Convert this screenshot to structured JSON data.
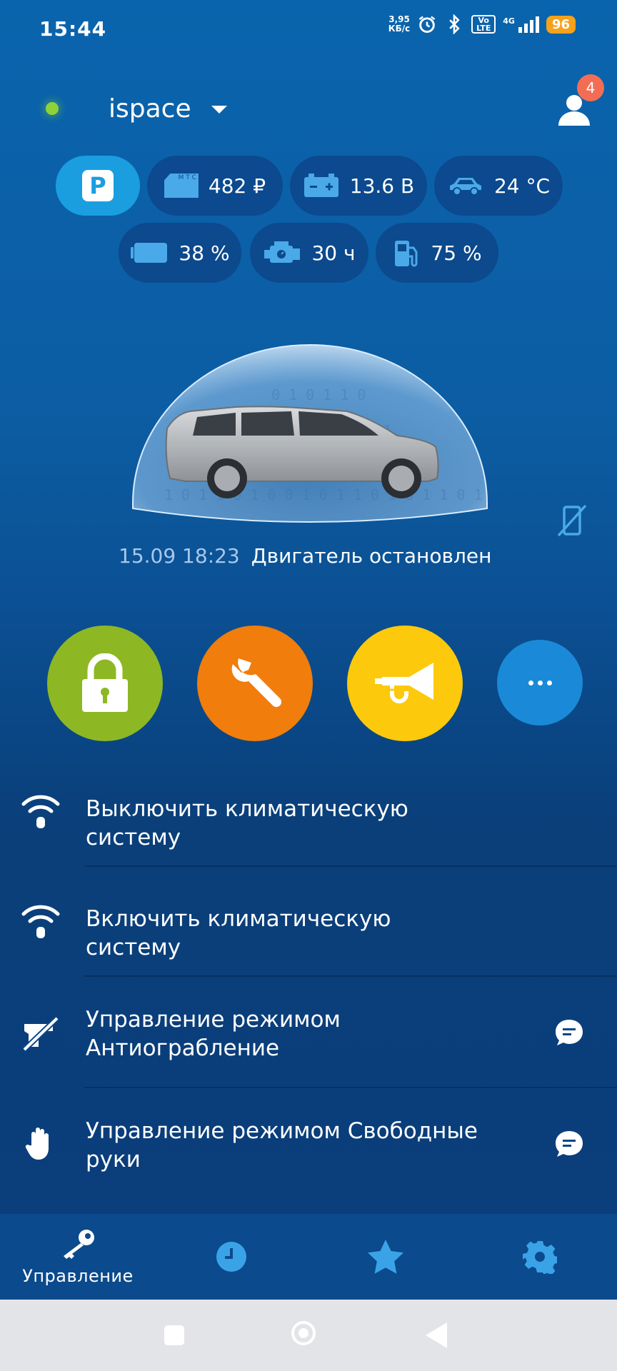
{
  "status_bar": {
    "time": "15:44",
    "net_speed_value": "3,95",
    "net_speed_unit": "КБ/с",
    "volte": "Vo LTE",
    "network": "4G",
    "battery": "96"
  },
  "header": {
    "device_name": "ispace",
    "notification_count": "4"
  },
  "chips": {
    "parking_label": "P",
    "balance": "482 ₽",
    "balance_icon_text": "M T C",
    "voltage": "13.6 В",
    "temperature": "24 °C",
    "battery_level": "38 %",
    "engine_hours": "30 ч",
    "fuel": "75 %"
  },
  "car_status": {
    "date": "15.09 18:23",
    "text": "Двигатель остановлен"
  },
  "menu": [
    {
      "label": "Выключить климатическую систему",
      "icon": "wifi-signal-icon"
    },
    {
      "label": "Включить климатическую систему",
      "icon": "wifi-signal-icon"
    },
    {
      "label": "Управление режимом Антиограбление",
      "icon": "no-gun-icon",
      "chat": true
    },
    {
      "label": "Управление режимом Свободные руки",
      "icon": "hand-icon",
      "chat": true
    }
  ],
  "bottom_nav": {
    "control_label": "Управление"
  },
  "colors": {
    "lock": "#8db823",
    "service": "#f07d0c",
    "horn": "#fcc90c",
    "more": "#1a8ad8",
    "parking": "#1a9ee0"
  }
}
